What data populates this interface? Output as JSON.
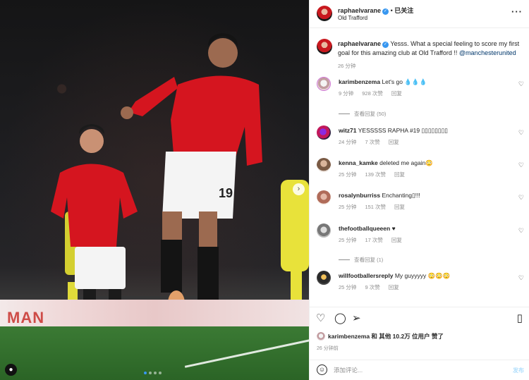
{
  "post": {
    "username": "raphaelvarane",
    "follow_label": "已关注",
    "location": "Old Trafford",
    "more_icon": "more-icon"
  },
  "photo": {
    "board_text": "MAN"
  },
  "caption": {
    "username": "raphaelvarane",
    "text": "Yesss. What a special feeling to score my first goal for this amazing club at Old Trafford !! ",
    "mention": "@manchesterunited",
    "time": "26 分钟"
  },
  "comments": [
    {
      "username": "karimbenzema",
      "text": "Let's go 💧💧💧",
      "time": "9 分钟",
      "likes": "928 次赞",
      "reply": "回复",
      "view_replies": "查看回复 (50)"
    },
    {
      "username": "witz71",
      "text": "YESSSSS RAPHA #19 ▯▯▯▯▯▯▯▯",
      "time": "24 分钟",
      "likes": "7 次赞",
      "reply": "回复"
    },
    {
      "username": "kenna_kamke",
      "text": "deleted me again😳",
      "time": "25 分钟",
      "likes": "139 次赞",
      "reply": "回复"
    },
    {
      "username": "rosalynburriss",
      "text": "Enchanting▯!!!",
      "time": "25 分钟",
      "likes": "151 次赞",
      "reply": "回复"
    },
    {
      "username": "thefootballqueeen",
      "text": "♥",
      "time": "25 分钟",
      "likes": "17 次赞",
      "reply": "回复",
      "view_replies": "查看回复 (1)"
    },
    {
      "username": "willfootballersreply",
      "text": "My guyyyyy 😳😳😳",
      "time": "25 分钟",
      "likes": "9 次赞",
      "reply": "回复"
    }
  ],
  "likes_line": {
    "username": "karimbenzema",
    "rest": " 和 其他 10.2万 位用户 赞了"
  },
  "post_time": "26 分钟前",
  "add_comment": {
    "placeholder": "添加评论...",
    "post_label": "发布"
  },
  "colors": {
    "link": "#00376b",
    "verified": "#3897f0",
    "muted": "#8e8e8e",
    "post_button": "#b2dffc"
  }
}
